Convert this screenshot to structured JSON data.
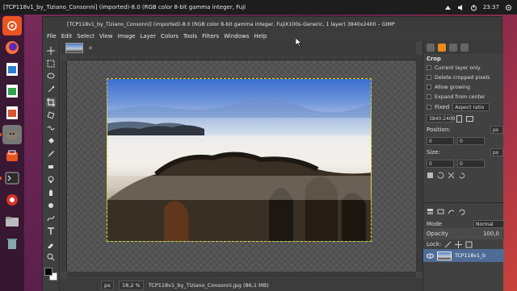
{
  "topbar": {
    "title": "[TCP118v1_by_Tiziano_Consonni] (imported)-8.0 (RGB color 8-bit gamma integer, Fuji",
    "time": "23:37"
  },
  "launcher": {
    "items": [
      "dash-icon",
      "firefox-icon",
      "libreoffice-writer-icon",
      "libreoffice-calc-icon",
      "libreoffice-impress-icon",
      "gimp-icon",
      "software-center-icon",
      "terminal-icon",
      "settings-icon",
      "files-icon",
      "trash-icon"
    ]
  },
  "window": {
    "title": "[TCP118v1_by_Tiziano_Consonni] (imported)-8.0 (RGB color 8-bit gamma integer, FujiX100s-Generic, 1 layer) 3840x2400 – GIMP",
    "menus": [
      "File",
      "Edit",
      "Select",
      "View",
      "Image",
      "Layer",
      "Colors",
      "Tools",
      "Filters",
      "Windows",
      "Help"
    ]
  },
  "statusbar": {
    "unit": "px",
    "zoom": "18,2 %",
    "file_info": "TCP118v1_by_Tiziano_Consonni.jpg (86,1 MB)"
  },
  "dock": {
    "tool_options_title": "Crop",
    "options": [
      "Current layer only",
      "Delete cropped pixels",
      "Allow growing",
      "Expand from center"
    ],
    "fixed_label": "Fixed",
    "fixed_value": "Aspect ratio",
    "ratio_value": "3840:2400",
    "position_label": "Position:",
    "position_unit": "px",
    "position_x": "0",
    "position_y": "0",
    "size_label": "Size:",
    "size_unit": "px",
    "size_w": "0",
    "size_h": "0",
    "mode_label": "Mode",
    "mode_value": "Normal",
    "opacity_label": "Opacity",
    "opacity_value": "100,0",
    "lock_label": "Lock:",
    "layer_name": "TCP118v1_b"
  },
  "colors": {
    "accent": "#ec8a1a",
    "ubuntu_orange": "#e95420",
    "selection": "#e6d400",
    "layer_highlight": "#4f6c96"
  }
}
